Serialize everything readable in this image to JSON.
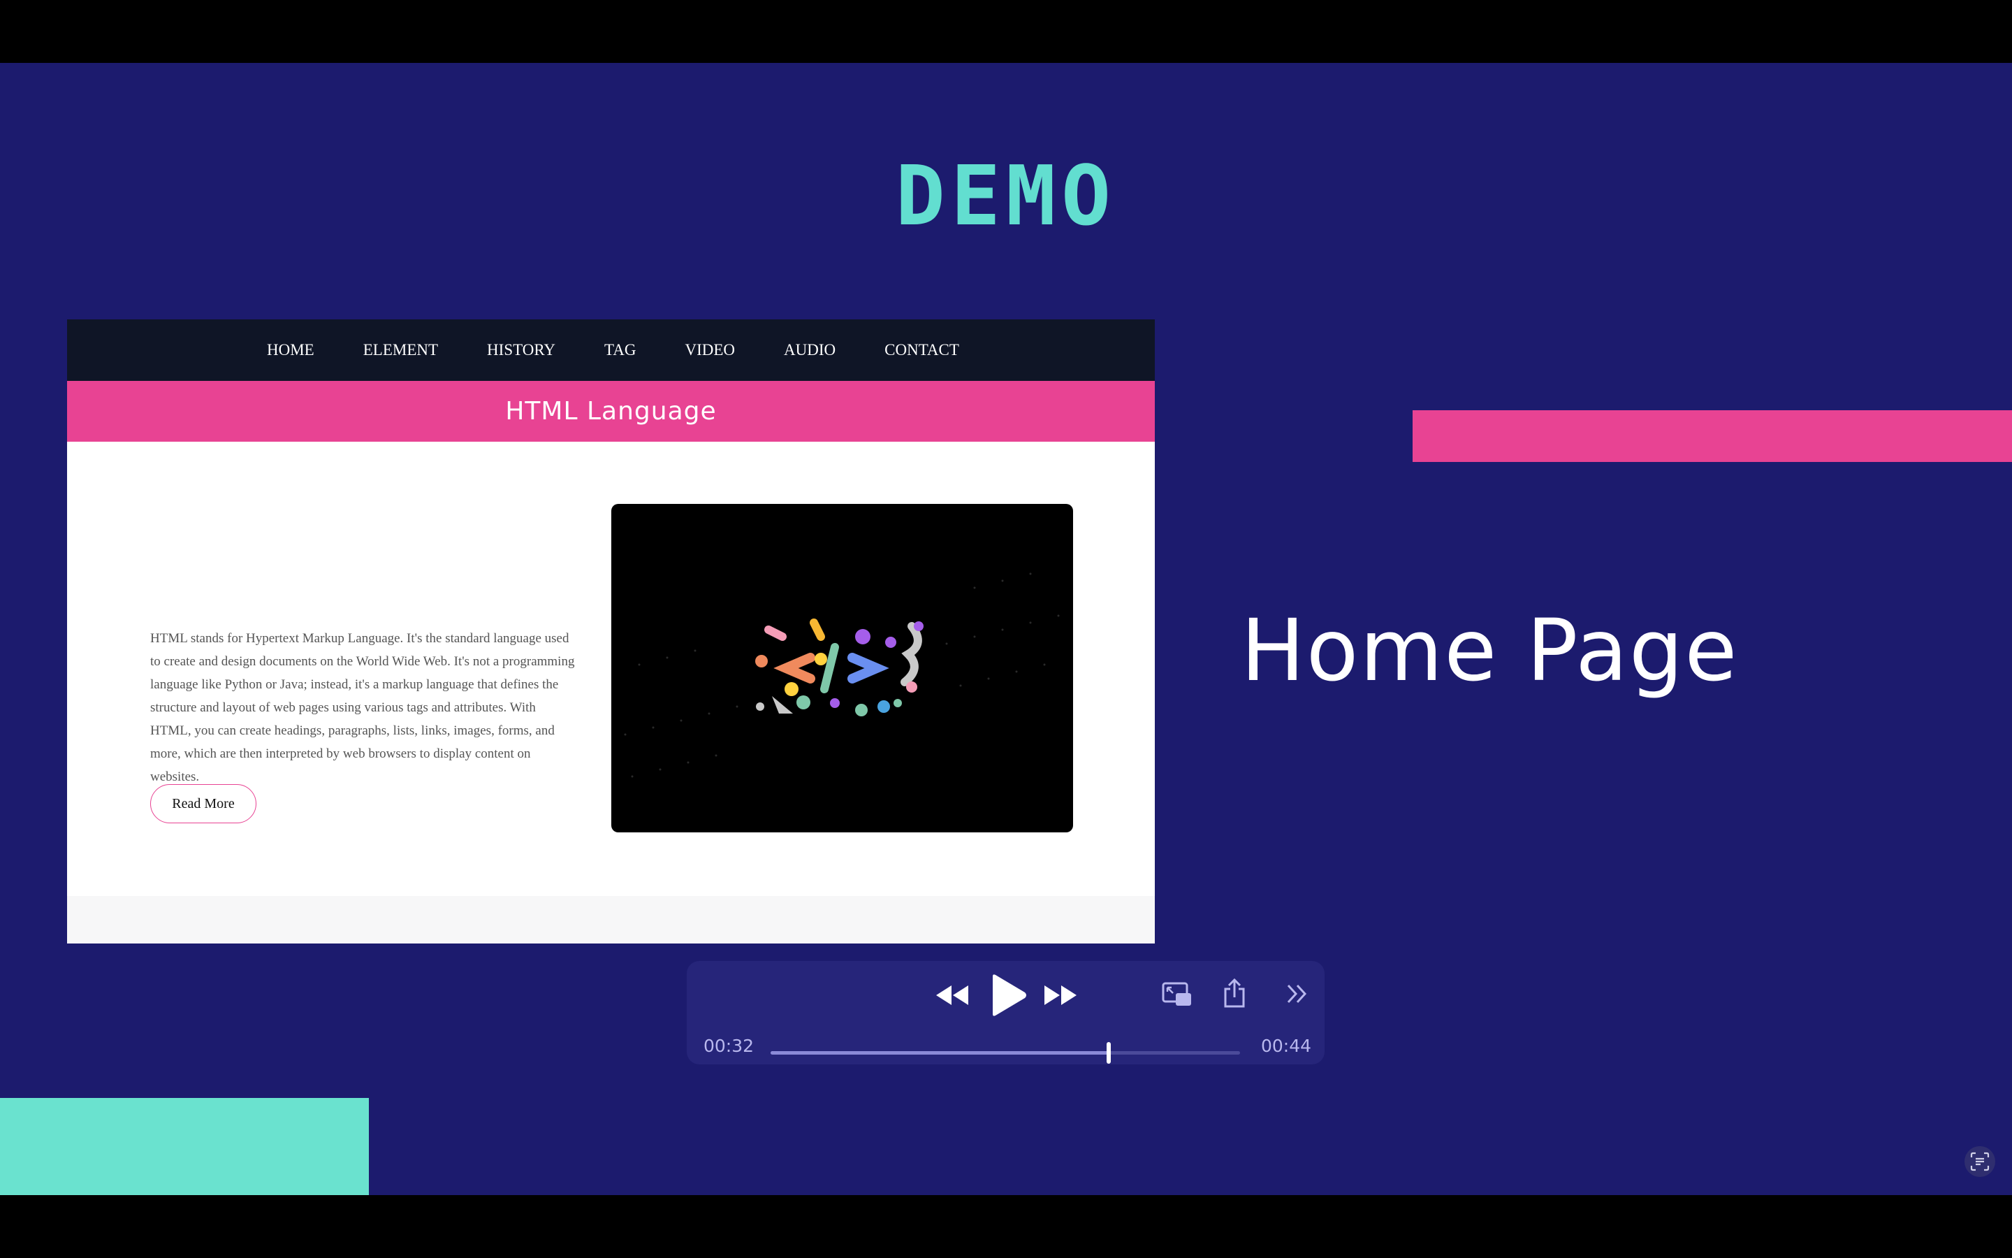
{
  "slide": {
    "title": "DEMO",
    "side_label": "Home Page",
    "colors": {
      "background": "#1c1b6e",
      "accent_pink": "#e84393",
      "accent_mint": "#6ae2cf",
      "title": "#62ded0"
    }
  },
  "site": {
    "nav": [
      "HOME",
      "ELEMENT",
      "HISTORY",
      "TAG",
      "VIDEO",
      "AUDIO",
      "CONTACT"
    ],
    "banner_title": "HTML Language",
    "paragraph": "HTML stands for Hypertext Markup Language. It's the standard language used to create and design documents on the World Wide Web. It's not a programming language like Python or Java; instead, it's a markup language that defines the structure and layout of web pages using various tags and attributes. With HTML, you can create headings, paragraphs, lists, links, images, forms, and more, which are then interpreted by web browsers to display content on websites.",
    "read_more_label": "Read More",
    "video_icon": "html-code-brackets-illustration"
  },
  "player": {
    "elapsed": "00:32",
    "remaining": "00:44",
    "progress": 0.72,
    "icons": [
      "rewind-icon",
      "play-icon",
      "fast-forward-icon",
      "picture-in-picture-icon",
      "share-icon",
      "more-chevrons-icon"
    ]
  },
  "overlay": {
    "icon": "live-text-icon"
  }
}
